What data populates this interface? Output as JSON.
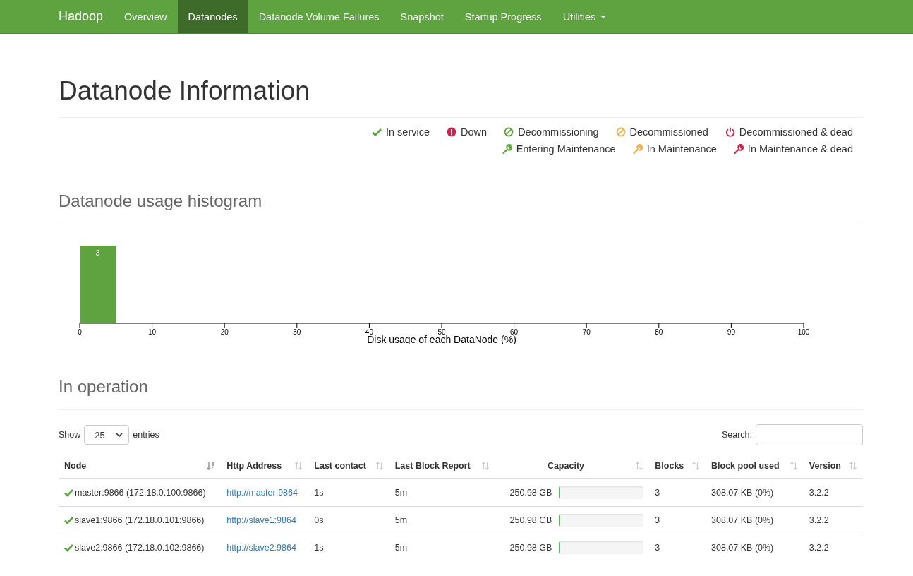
{
  "navbar": {
    "brand": "Hadoop",
    "items": [
      {
        "label": "Overview",
        "selected": false,
        "dropdown": false
      },
      {
        "label": "Datanodes",
        "selected": true,
        "dropdown": false
      },
      {
        "label": "Datanode Volume Failures",
        "selected": false,
        "dropdown": false
      },
      {
        "label": "Snapshot",
        "selected": false,
        "dropdown": false
      },
      {
        "label": "Startup Progress",
        "selected": false,
        "dropdown": false
      },
      {
        "label": "Utilities",
        "selected": false,
        "dropdown": true
      }
    ]
  },
  "title": "Datanode Information",
  "legend": [
    [
      {
        "kind": "check",
        "label": "In service",
        "color": "#5fa341"
      },
      {
        "kind": "alert",
        "label": "Down",
        "color": "#c7254e"
      },
      {
        "kind": "ban",
        "label": "Decommissioning",
        "color": "#5fa341"
      },
      {
        "kind": "ban",
        "label": "Decommissioned",
        "color": "#f0ad4e"
      },
      {
        "kind": "power",
        "label": "Decommissioned & dead",
        "color": "#c7254e"
      }
    ],
    [
      {
        "kind": "wrench",
        "label": "Entering Maintenance",
        "color": "#5fa341"
      },
      {
        "kind": "wrench",
        "label": "In Maintenance",
        "color": "#f0ad4e"
      },
      {
        "kind": "wrench",
        "label": "In Maintenance & dead",
        "color": "#c7254e"
      }
    ]
  ],
  "histogram": {
    "heading": "Datanode usage histogram",
    "chart_data": {
      "type": "bar",
      "xlabel": "Disk usage of each DataNode (%)",
      "x": [
        2.5
      ],
      "values": [
        3
      ],
      "xlim": [
        0,
        100
      ],
      "xticks": [
        0,
        10,
        20,
        30,
        40,
        50,
        60,
        70,
        80,
        90,
        100
      ],
      "data_labels": true
    }
  },
  "operation": {
    "heading": "In operation",
    "show_label": "Show",
    "page_size": "25",
    "entries_label": "entries",
    "search_label": "Search:",
    "columns": [
      {
        "label": "Node",
        "sorted": true
      },
      {
        "label": "Http Address",
        "sorted": false
      },
      {
        "label": "Last contact",
        "sorted": false
      },
      {
        "label": "Last Block Report",
        "sorted": false
      },
      {
        "label": "Capacity",
        "sorted": false
      },
      {
        "label": "Blocks",
        "sorted": false
      },
      {
        "label": "Block pool used",
        "sorted": false
      },
      {
        "label": "Version",
        "sorted": false
      }
    ],
    "rows": [
      {
        "node": "master:9866 (172.18.0.100:9866)",
        "in_service": true,
        "http": "http://master:9864",
        "last_contact": "1s",
        "last_block_report": "5m",
        "capacity": "250.98 GB",
        "level": 0.01,
        "blocks": "3",
        "block_pool_used": "308.07 KB (0%)",
        "version": "3.2.2"
      },
      {
        "node": "slave1:9866 (172.18.0.101:9866)",
        "in_service": true,
        "http": "http://slave1:9864",
        "last_contact": "0s",
        "last_block_report": "5m",
        "capacity": "250.98 GB",
        "level": 0.01,
        "blocks": "3",
        "block_pool_used": "308.07 KB (0%)",
        "version": "3.2.2"
      },
      {
        "node": "slave2:9866 (172.18.0.102:9866)",
        "in_service": true,
        "http": "http://slave2:9864",
        "last_contact": "1s",
        "last_block_report": "5m",
        "capacity": "250.98 GB",
        "level": 0.01,
        "blocks": "3",
        "block_pool_used": "308.07 KB (0%)",
        "version": "3.2.2"
      }
    ]
  }
}
